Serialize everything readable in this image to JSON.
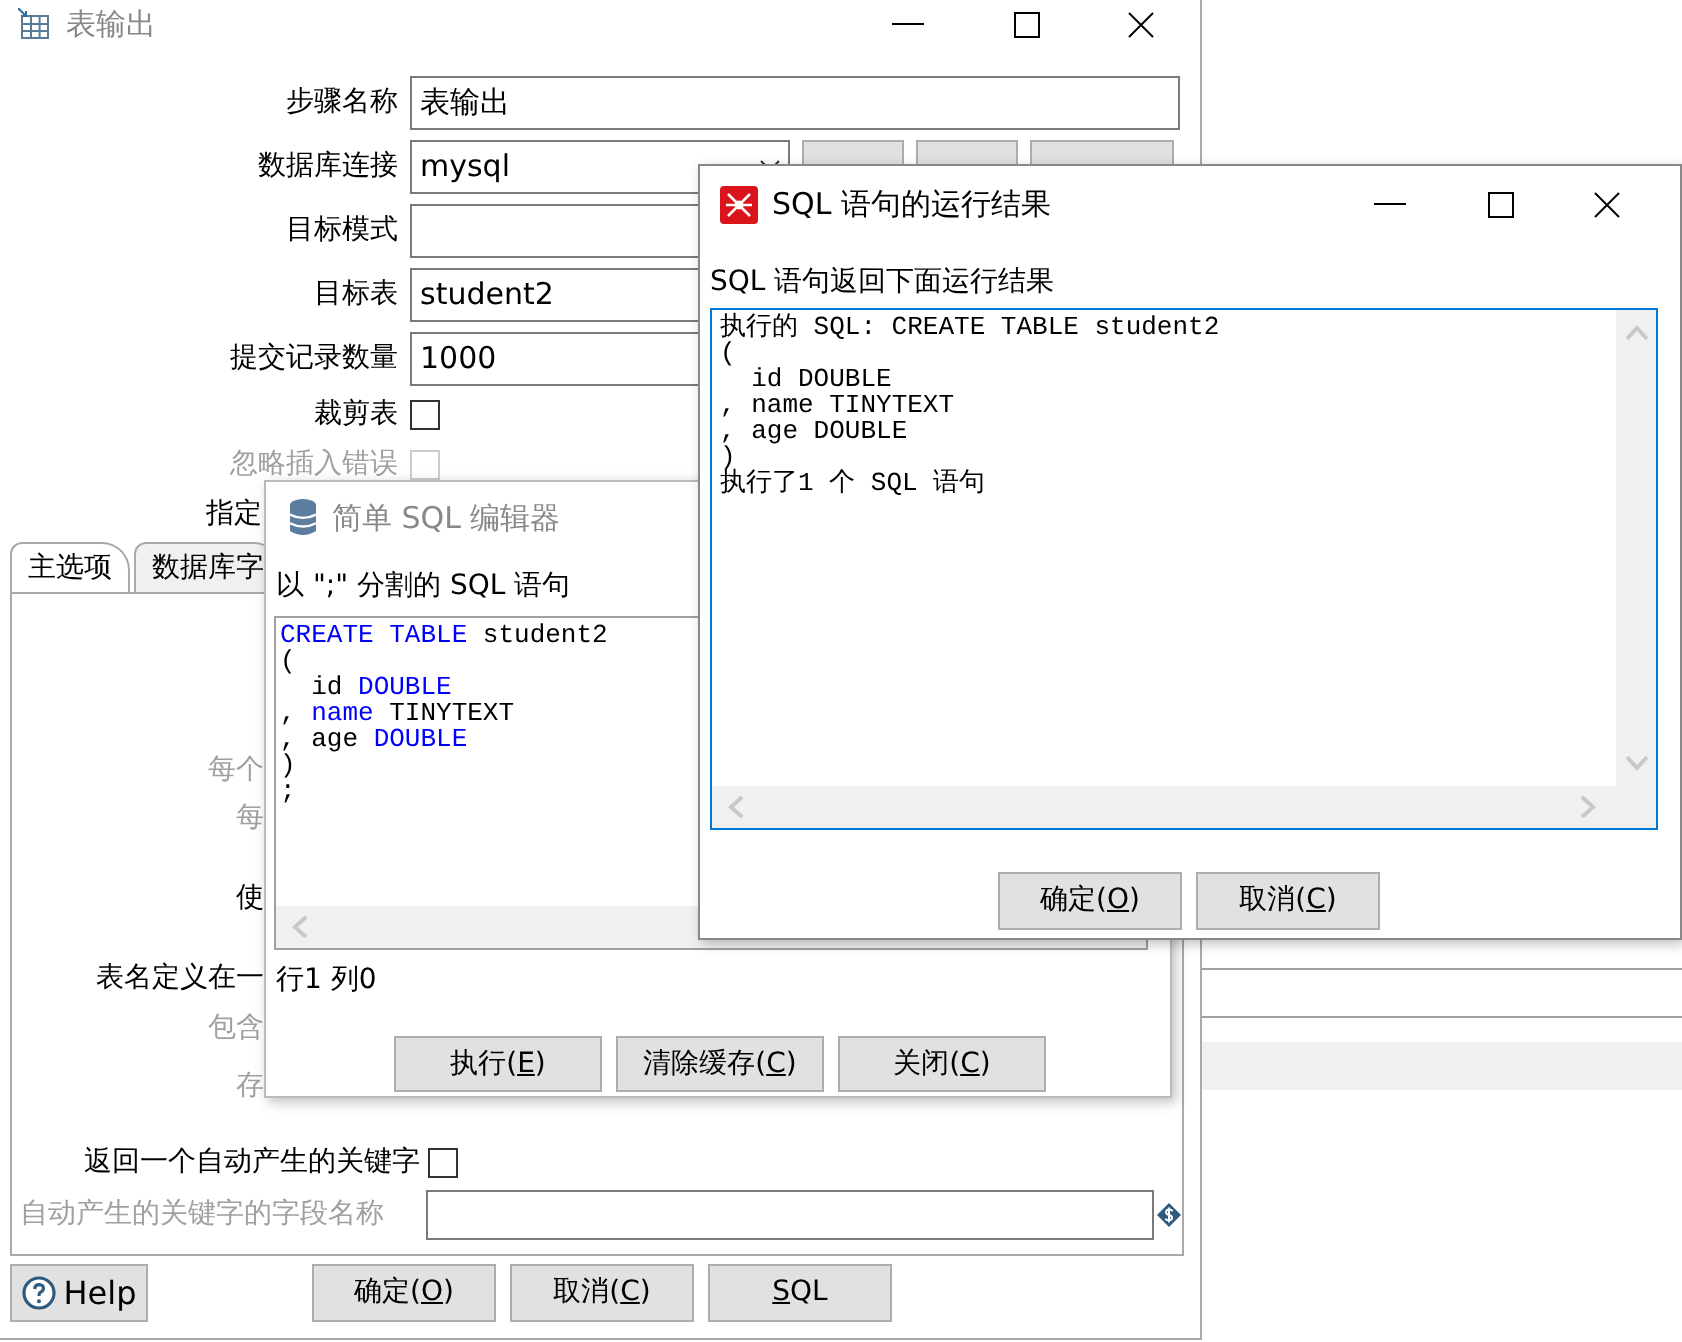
{
  "main_window": {
    "title": "表输出",
    "fields": [
      {
        "kind": "text",
        "label": "步骤名称",
        "value": "表输出"
      },
      {
        "kind": "combo",
        "label": "数据库连接",
        "value": "mysql"
      },
      {
        "kind": "text",
        "label": "目标模式"
      },
      {
        "kind": "text",
        "label": "目标表",
        "value": "student2"
      },
      {
        "kind": "text",
        "label": "提交记录数量",
        "value": "1000"
      },
      {
        "kind": "checkbox",
        "label": "裁剪表",
        "checked": false,
        "disabled": false
      },
      {
        "kind": "checkbox",
        "label": "忽略插入错误",
        "checked": false,
        "disabled": true
      },
      {
        "kind": "clipped",
        "label": "指定",
        "disabled": false
      }
    ],
    "tabs": [
      {
        "label": "主选项",
        "selected": true
      },
      {
        "label": "数据库字",
        "selected": false
      }
    ],
    "panel_rows": [
      {
        "kind": "clipped",
        "label": "每个",
        "disabled": true
      },
      {
        "kind": "clipped",
        "label": "每",
        "disabled": true
      },
      {
        "kind": "clipped",
        "label": "使",
        "disabled": false
      },
      {
        "kind": "clipped",
        "label": "表名定义在一",
        "disabled": false
      },
      {
        "kind": "clipped",
        "label": "包含",
        "disabled": true
      },
      {
        "kind": "clipped",
        "label": "存",
        "disabled": true
      },
      {
        "kind": "checkbox",
        "label": "返回一个自动产生的关键字",
        "checked": false,
        "disabled": false
      },
      {
        "kind": "variable_text",
        "label": "自动产生的关键字的字段名称",
        "disabled": true
      }
    ],
    "buttons": [
      {
        "kind": "help",
        "text": "Help"
      },
      {
        "kind": "mnemonic",
        "text": "确定(",
        "key": "O",
        "after": ")"
      },
      {
        "kind": "mnemonic",
        "text": "取消(",
        "key": "C",
        "after": ")"
      },
      {
        "kind": "mnemonic",
        "key": "S",
        "after": "QL"
      }
    ]
  },
  "sql_editor": {
    "title": "简单 SQL 编辑器",
    "prompt": "以 \";\" 分割的 SQL 语句",
    "lines": [
      [
        {
          "text": "CREATE TABLE",
          "kind": "keyword"
        },
        {
          "text": " student2",
          "kind": "plain"
        }
      ],
      [
        {
          "text": "(",
          "kind": "plain"
        }
      ],
      [
        {
          "text": "  id ",
          "kind": "plain"
        },
        {
          "text": "DOUBLE",
          "kind": "keyword"
        }
      ],
      [
        {
          "text": ", ",
          "kind": "plain"
        },
        {
          "text": "name",
          "kind": "keyword"
        },
        {
          "text": " TINYTEXT",
          "kind": "plain"
        }
      ],
      [
        {
          "text": ", age ",
          "kind": "plain"
        },
        {
          "text": "DOUBLE",
          "kind": "keyword"
        }
      ],
      [
        {
          "text": ")",
          "kind": "plain"
        }
      ],
      [
        {
          "text": ";",
          "kind": "plain"
        }
      ]
    ],
    "status": "行1 列0",
    "buttons": [
      {
        "kind": "mnemonic",
        "text": "执行(",
        "key": "E",
        "after": ")"
      },
      {
        "kind": "mnemonic",
        "text": "清除缓存(",
        "key": "C",
        "after": ")"
      },
      {
        "kind": "mnemonic",
        "text": "关闭(",
        "key": "C",
        "after": ")"
      }
    ]
  },
  "result_dialog": {
    "title": "SQL 语句的运行结果",
    "prompt": "SQL 语句返回下面运行结果",
    "output": [
      "执行的 SQL: CREATE TABLE student2",
      "(",
      "  id DOUBLE",
      ", name TINYTEXT",
      ", age DOUBLE",
      ")",
      "执行了1 个 SQL 语句"
    ],
    "buttons": [
      {
        "kind": "mnemonic",
        "text": "确定(",
        "key": "O",
        "after": ")"
      },
      {
        "kind": "mnemonic",
        "text": "取消(",
        "key": "C",
        "after": ")"
      }
    ]
  }
}
